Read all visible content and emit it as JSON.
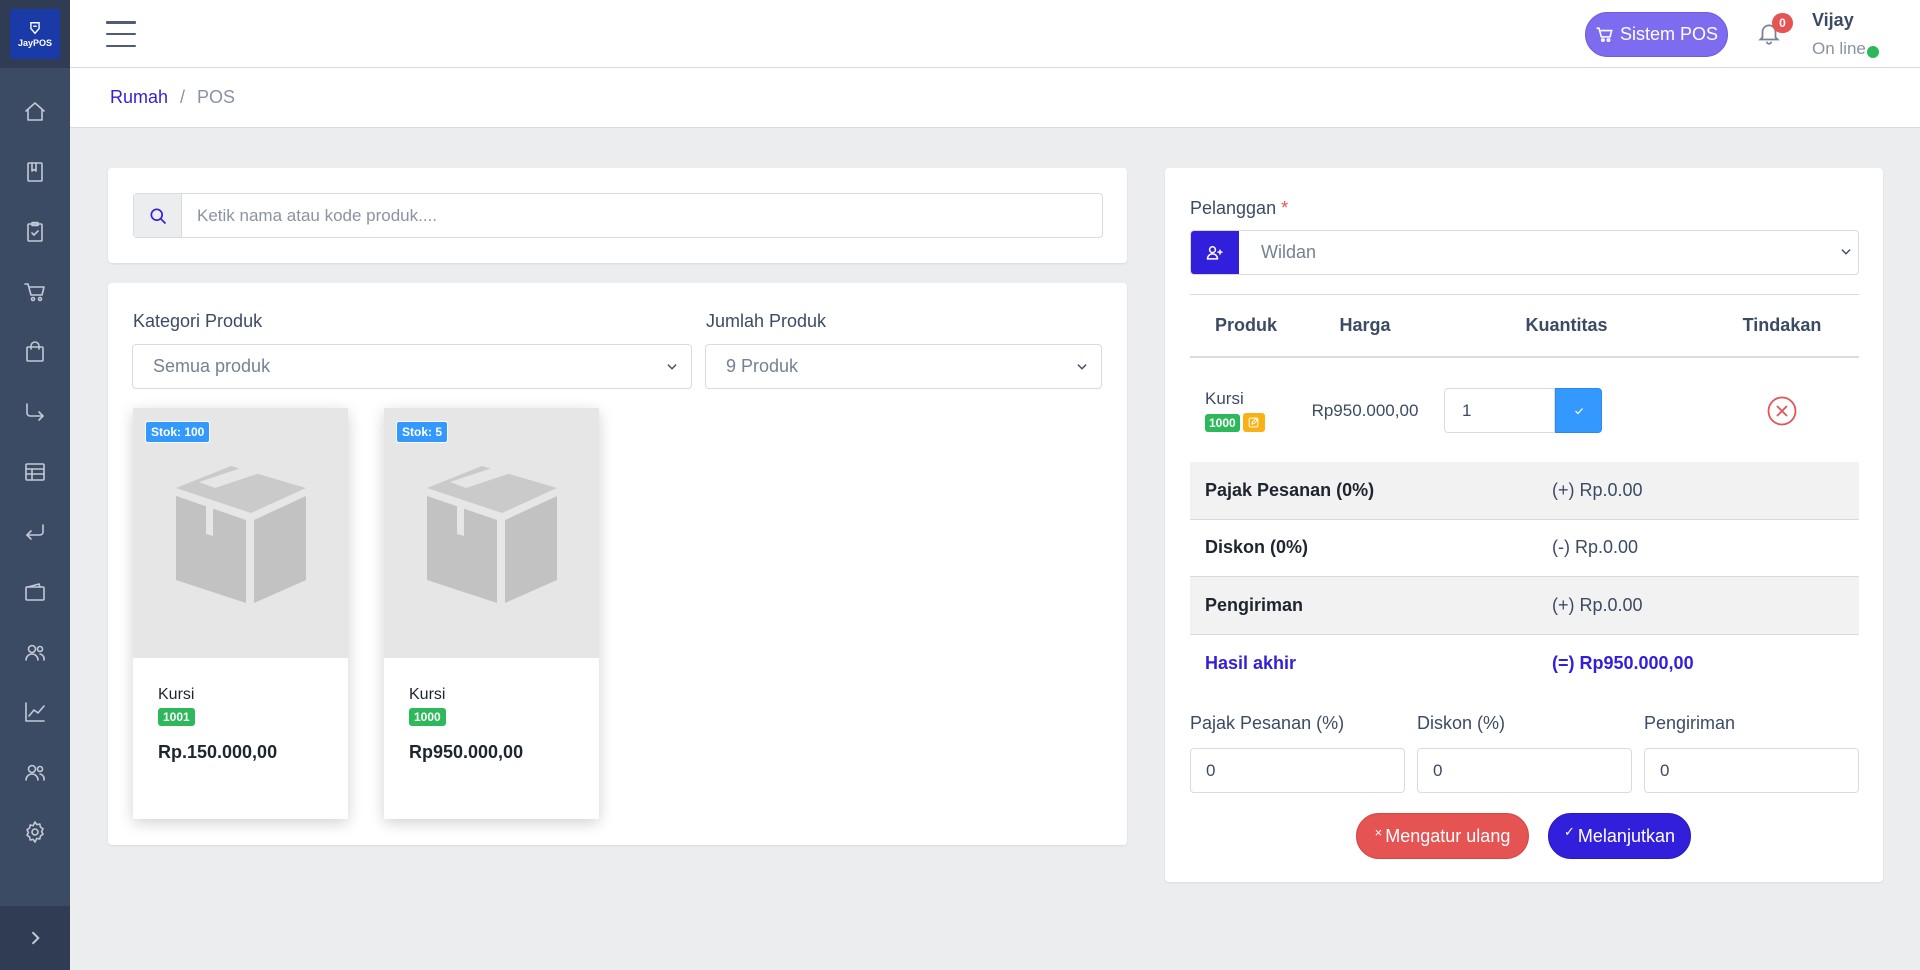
{
  "brand": {
    "name": "JayPOS"
  },
  "sidebar": {
    "items": [
      {
        "icon": "home-icon",
        "name": "sidebar-item-home"
      },
      {
        "icon": "book-icon",
        "name": "sidebar-item-products"
      },
      {
        "icon": "clipboard-icon",
        "name": "sidebar-item-orders"
      },
      {
        "icon": "cart-icon",
        "name": "sidebar-item-sales"
      },
      {
        "icon": "bag-icon",
        "name": "sidebar-item-purchases"
      },
      {
        "icon": "arrow-turn-icon",
        "name": "sidebar-item-transfers"
      },
      {
        "icon": "spreadsheet-icon",
        "name": "sidebar-item-reports-table"
      },
      {
        "icon": "return-icon",
        "name": "sidebar-item-returns"
      },
      {
        "icon": "wallet-icon",
        "name": "sidebar-item-expenses"
      },
      {
        "icon": "users-icon",
        "name": "sidebar-item-people"
      },
      {
        "icon": "chart-icon",
        "name": "sidebar-item-reports"
      },
      {
        "icon": "group-icon",
        "name": "sidebar-item-users"
      },
      {
        "icon": "gear-icon",
        "name": "sidebar-item-settings"
      }
    ]
  },
  "header": {
    "pos_button": "Sistem POS",
    "notification_count": "0",
    "user_name": "Vijay",
    "user_status": "On line"
  },
  "breadcrumb": {
    "home": "Rumah",
    "separator": "/",
    "current": "POS"
  },
  "search": {
    "placeholder": "Ketik nama atau kode produk...."
  },
  "filters": {
    "category_label": "Kategori Produk",
    "category_value": "Semua produk",
    "count_label": "Jumlah Produk",
    "count_value": "9 Produk"
  },
  "products": [
    {
      "stock": "Stok: 100",
      "name": "Kursi",
      "code": "1001",
      "price": "Rp.150.000,00"
    },
    {
      "stock": "Stok: 5",
      "name": "Kursi",
      "code": "1000",
      "price": "Rp950.000,00"
    }
  ],
  "cart": {
    "customer_label": "Pelanggan",
    "customer_required": "*",
    "customer_value": "Wildan",
    "columns": [
      "Produk",
      "Harga",
      "Kuantitas",
      "Tindakan"
    ],
    "rows": [
      {
        "name": "Kursi",
        "code": "1000",
        "price": "Rp950.000,00",
        "qty": "1"
      }
    ],
    "summary": [
      {
        "label": "Pajak Pesanan (0%)",
        "value": "(+) Rp.0.00"
      },
      {
        "label": "Diskon (0%)",
        "value": "(-) Rp.0.00"
      },
      {
        "label": "Pengiriman",
        "value": "(+) Rp.0.00"
      },
      {
        "label": "Hasil akhir",
        "value": "(=) Rp950.000,00"
      }
    ],
    "tax_label": "Pajak Pesanan (%)",
    "tax_value": "0",
    "discount_label": "Diskon (%)",
    "discount_value": "0",
    "shipping_label": "Pengiriman",
    "shipping_value": "0",
    "reset_icon": "×",
    "reset_label": "Mengatur ulang",
    "proceed_icon": "✓",
    "proceed_label": "Melanjutkan"
  },
  "colors": {
    "primary": "#321fdb",
    "sidebar": "#3c4b64",
    "danger": "#e55353",
    "success": "#2eb85c",
    "info": "#3399ff",
    "warning": "#f9b115",
    "pos_button": "#7e6cf0"
  }
}
